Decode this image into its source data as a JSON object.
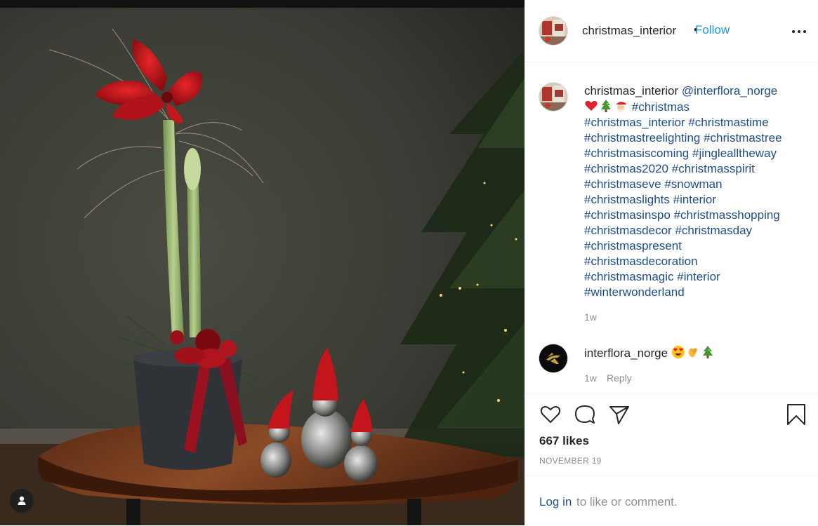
{
  "post": {
    "username": "christmas_interior",
    "dot": "•",
    "follow_label": "Follow",
    "more_icon": "more-options-icon"
  },
  "caption": {
    "username": "christmas_interior",
    "mention": "@interflora_norge",
    "emojis": [
      "heart",
      "christmas-tree",
      "santa"
    ],
    "hashtags": [
      "#christmas",
      "#christmas_interior",
      "#christmastime",
      "#christmastreelighting",
      "#christmastree",
      "#christmasiscoming",
      "#jinglealltheway",
      "#christmas2020",
      "#christmasspirit",
      "#christmaseve",
      "#snowman",
      "#christmaslights",
      "#interior",
      "#christmasinspo",
      "#christmasshopping",
      "#christmasdecor",
      "#christmasday",
      "#christmaspresent",
      "#christmasdecoration",
      "#christmasmagic",
      "#interior",
      "#winterwonderland"
    ],
    "time": "1w"
  },
  "comment": {
    "username": "interflora_norge",
    "emojis": [
      "heart-eyes",
      "clapping-hands",
      "christmas-tree"
    ],
    "time": "1w",
    "reply_label": "Reply"
  },
  "actions": {
    "like_icon": "heart-icon",
    "comment_icon": "comment-icon",
    "share_icon": "share-icon",
    "save_icon": "bookmark-icon"
  },
  "likes": "667 likes",
  "date": "NOVEMBER 19",
  "login": {
    "link": "Log in",
    "rest": "to like or comment."
  },
  "colors": {
    "link_blue": "#1a94e4",
    "hashtag": "#1f4e8a",
    "muted": "#8e8e8e"
  }
}
